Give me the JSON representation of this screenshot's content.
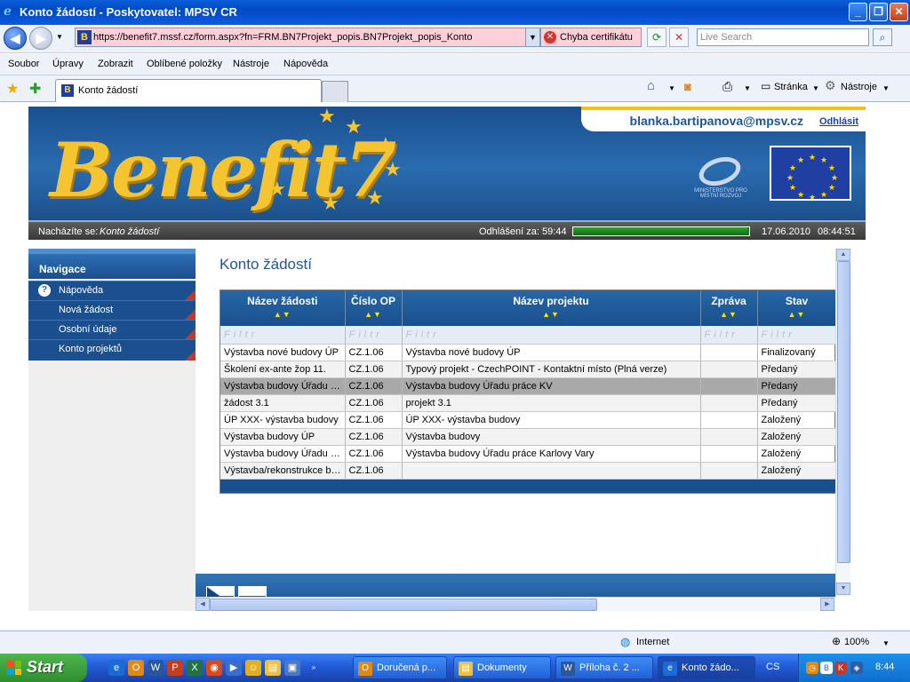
{
  "window": {
    "title": "Konto žádostí - Poskytovatel: MPSV CR"
  },
  "browser": {
    "url": "https://benefit7.mssf.cz/form.aspx?fn=FRM.BN7Projekt_popis.BN7Projekt_popis_Konto",
    "cert_error": "Chyba certifikátu",
    "search_placeholder": "Live Search",
    "menu": [
      "Soubor",
      "Úpravy",
      "Zobrazit",
      "Oblíbené položky",
      "Nástroje",
      "Nápověda"
    ],
    "tab_label": "Konto žádostí",
    "tools": {
      "page": "Stránka",
      "tools": "Nástroje"
    },
    "status_zone": "Internet",
    "zoom": "100%"
  },
  "app": {
    "user_email": "blanka.bartipanova@mpsv.cz",
    "logout": "Odhlásit",
    "ministry": "MINISTERSTVO PRO MÍSTNÍ ROZVOJ",
    "location_label": "Nacházíte se:",
    "location_value": "Konto žádostí",
    "logout_in_label": "Odhlášení za:",
    "logout_in_value": "59:44",
    "session_remaining_fraction": 0.99,
    "date": "17.06.2010",
    "time": "08:44:51",
    "nav": {
      "title": "Navigace",
      "items": [
        "Nápověda",
        "Nová žádost",
        "Osobní údaje",
        "Konto projektů"
      ]
    },
    "page_title": "Konto žádostí",
    "grid": {
      "columns": [
        "Název žádosti",
        "Číslo OP",
        "Název projektu",
        "Zpráva",
        "Stav"
      ],
      "filter_placeholder": "Filtr",
      "rows": [
        {
          "nazev": "Výstavba nové budovy ÚP",
          "cislo": "CZ.1.06",
          "projekt": "Výstavba nové budovy ÚP",
          "zprava": "",
          "stav": "Finalizovaný"
        },
        {
          "nazev": "Školení ex-ante žop 11.",
          "cislo": "CZ.1.06",
          "projekt": "Typový projekt - CzechPOINT - Kontaktní místo (Plná verze)",
          "zprava": "",
          "stav": "Předaný"
        },
        {
          "nazev": "Výstavba budovy Úřadu práce KV",
          "cislo": "CZ.1.06",
          "projekt": "Výstavba budovy Úřadu práce KV",
          "zprava": "",
          "stav": "Předaný"
        },
        {
          "nazev": "žádost 3.1",
          "cislo": "CZ.1.06",
          "projekt": "projekt 3.1",
          "zprava": "",
          "stav": "Předaný"
        },
        {
          "nazev": "ÚP XXX- výstavba budovy",
          "cislo": "CZ.1.06",
          "projekt": "ÚP XXX- výstavba budovy",
          "zprava": "",
          "stav": "Založený"
        },
        {
          "nazev": "Výstavba budovy ÚP",
          "cislo": "CZ.1.06",
          "projekt": "Výstavba budovy",
          "zprava": "",
          "stav": "Založený"
        },
        {
          "nazev": "Výstavba budovy Úřadu práce Karlovy Vary",
          "cislo": "CZ.1.06",
          "projekt": "Výstavba budovy Úřadu práce Karlovy Vary",
          "zprava": "",
          "stav": "Založený"
        },
        {
          "nazev": "Výstavba/rekonstrukce budovy",
          "cislo": "CZ.1.06",
          "projekt": "",
          "zprava": "",
          "stav": "Založený"
        }
      ],
      "selected_row": 2
    }
  },
  "taskbar": {
    "start": "Start",
    "tasks": [
      "Doručená p...",
      "Dokumenty",
      "Příloha č. 2 ...",
      "Konto žádo..."
    ],
    "lang": "CS",
    "clock": "8:44"
  },
  "colors": {
    "brand_blue": "#1a4f8c",
    "title_blue": "#1e5598",
    "star_yellow": "#f4c530",
    "cert_error_bg": "#ffd0d8"
  }
}
